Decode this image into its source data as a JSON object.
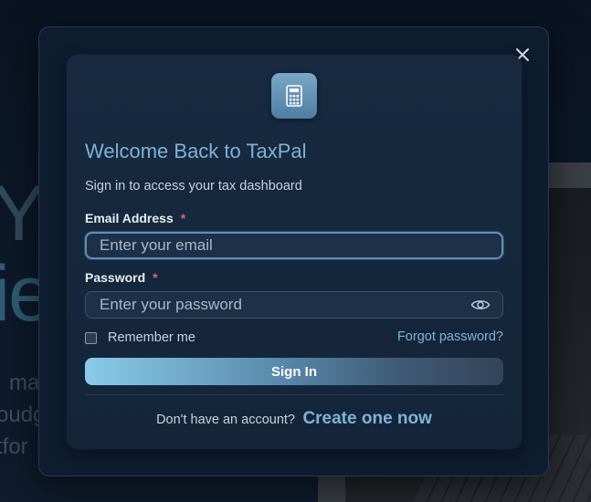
{
  "background": {
    "hero_line1": "Yo",
    "hero_line2": "ie",
    "sub_line1": "ma",
    "sub_line2": "oudg",
    "sub_line3": "tfor"
  },
  "modal": {
    "close_icon": "close-icon",
    "logo_icon": "calculator-icon",
    "title": "Welcome Back to TaxPal",
    "subtitle": "Sign in to access your tax dashboard",
    "email": {
      "label": "Email Address",
      "required_mark": "*",
      "placeholder": "Enter your email",
      "value": ""
    },
    "password": {
      "label": "Password",
      "required_mark": "*",
      "placeholder": "Enter your password",
      "value": "",
      "toggle_icon": "eye-icon"
    },
    "remember_me": {
      "label": "Remember me",
      "checked": false
    },
    "forgot_link": "Forgot password?",
    "signin_button": "Sign In",
    "signup_prompt": "Don't have an account?",
    "signup_link": "Create one now"
  },
  "colors": {
    "accent": "#7fb3d5",
    "required": "#e06464",
    "modal_bg": "#0e1c30",
    "card_bg": "#172a41"
  }
}
